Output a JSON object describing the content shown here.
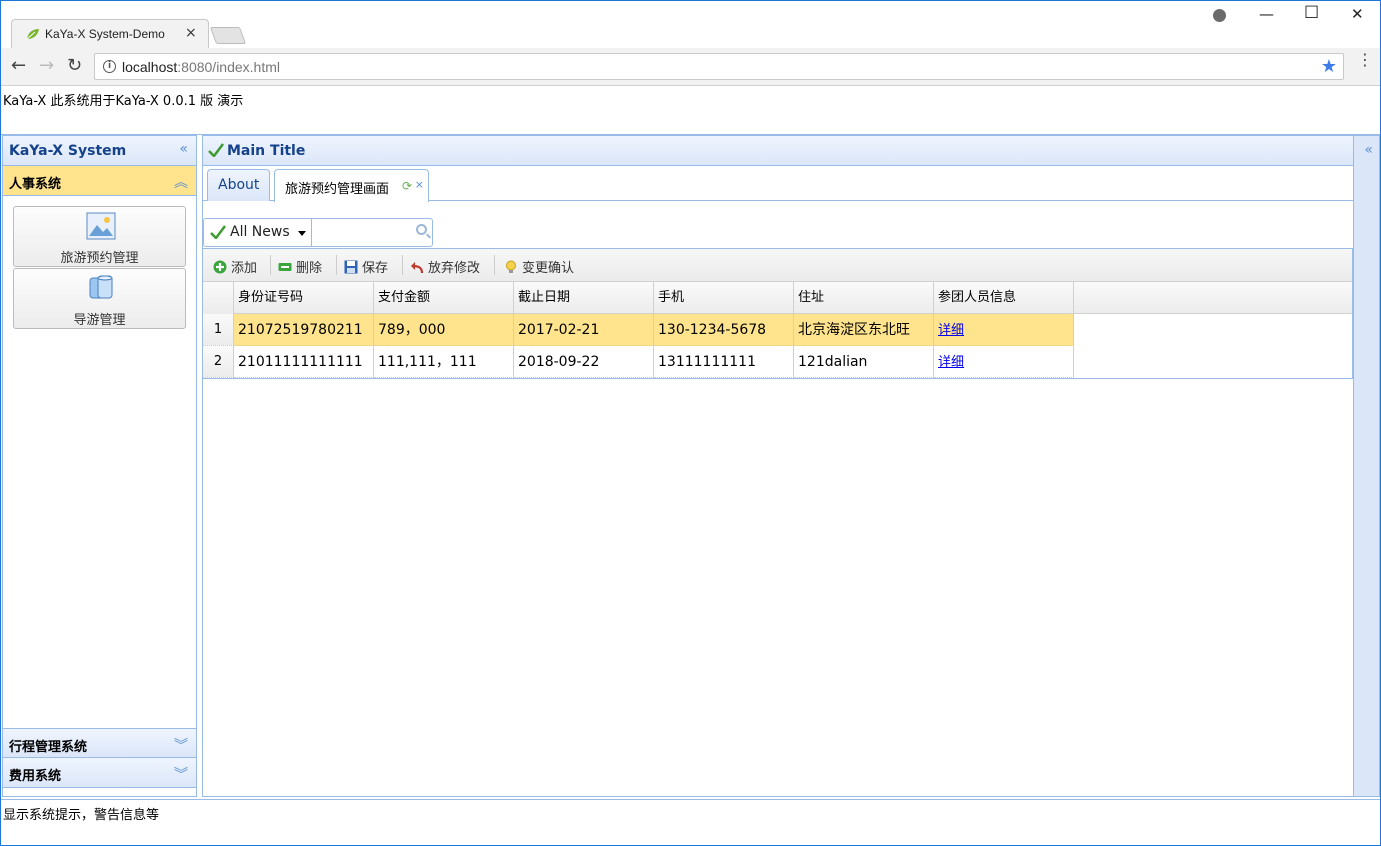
{
  "browser": {
    "tab_title": "KaYa-X System-Demo",
    "tab_close": "×",
    "url_host": "localhost",
    "url_rest": ":8080/index.html",
    "minimize": "—",
    "maximize": "☐",
    "close": "✕",
    "back": "←",
    "forward": "→",
    "reload": "↻",
    "star": "★",
    "menu": "⋮"
  },
  "header": {
    "text": "KaYa-X 此系统用于KaYa-X 0.0.1 版 演示"
  },
  "west": {
    "title": "KaYa-X System",
    "collapse": "«",
    "accordions": [
      {
        "label": "人事系统",
        "icon": "chevrons-up-icon",
        "toggle": "︽"
      },
      {
        "label": "行程管理系统",
        "icon": "chevrons-down-icon",
        "toggle": "︾"
      },
      {
        "label": "费用系统",
        "icon": "chevrons-down-icon",
        "toggle": "︾"
      }
    ],
    "buttons": [
      {
        "label": "旅游预约管理",
        "icon": "image-icon"
      },
      {
        "label": "导游管理",
        "icon": "database-icon"
      }
    ]
  },
  "center": {
    "title": "Main Title",
    "tabs": [
      {
        "label": "About"
      },
      {
        "label": "旅游预约管理画面",
        "close": "×",
        "refresh": "⟳"
      }
    ],
    "search": {
      "menu_label": "All News",
      "value": ""
    },
    "toolbar": [
      {
        "label": "添加",
        "icon": "add-icon"
      },
      {
        "label": "删除",
        "icon": "remove-icon"
      },
      {
        "label": "保存",
        "icon": "save-icon"
      },
      {
        "label": "放弃修改",
        "icon": "undo-icon"
      },
      {
        "label": "变更确认",
        "icon": "lightbulb-icon"
      }
    ],
    "grid": {
      "columns": [
        "身份证号码",
        "支付金额",
        "截止日期",
        "手机",
        "住址",
        "参团人员信息"
      ],
      "rows": [
        {
          "num": "1",
          "cells": [
            "21072519780211",
            "789，000",
            "2017-02-21",
            "130-1234-5678",
            "北京海淀区东北旺",
            "详细"
          ]
        },
        {
          "num": "2",
          "cells": [
            "21011111111111",
            "111,111，111",
            "2018-09-22",
            "13111111111",
            "121dalian",
            "详细"
          ]
        }
      ]
    }
  },
  "east": {
    "collapse": "«"
  },
  "footer": {
    "text": "显示系统提示，警告信息等"
  },
  "colors": {
    "accent": "#99bbe8",
    "selected_row": "#ffe48d",
    "title_text": "#15428b"
  }
}
